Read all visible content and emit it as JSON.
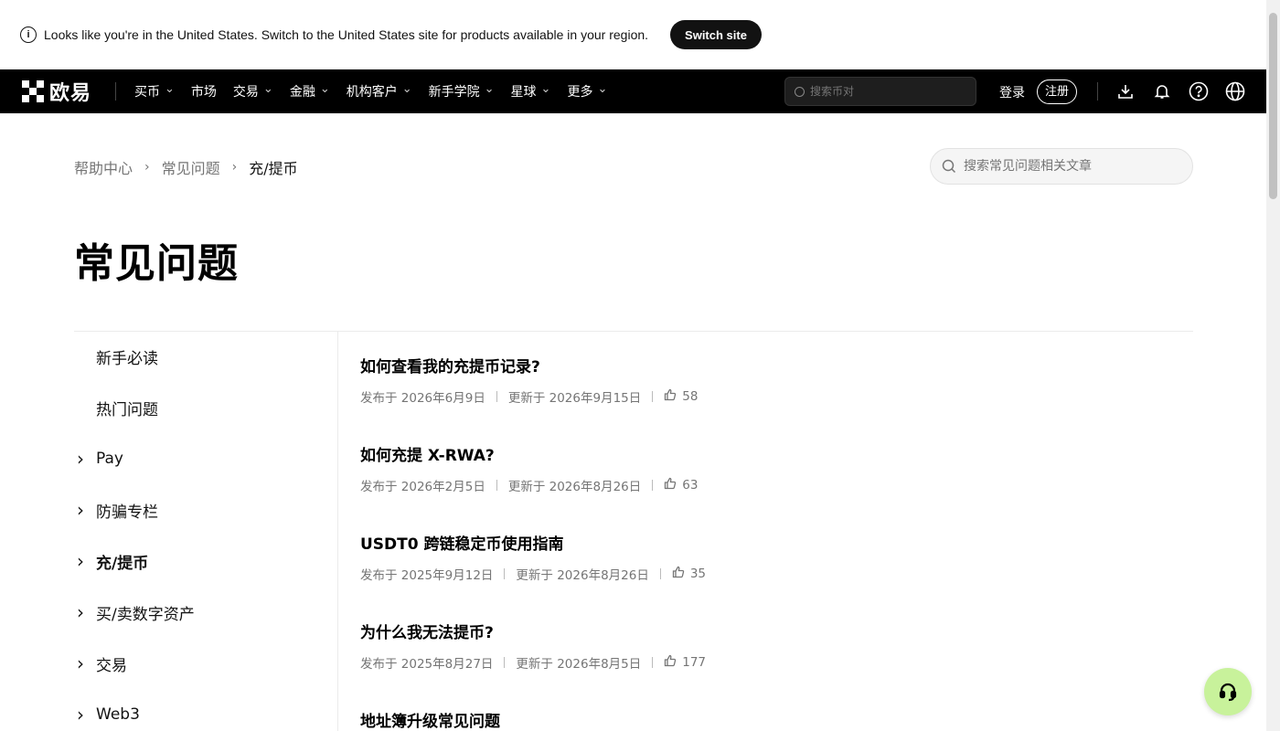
{
  "banner": {
    "message": "Looks like you're in the United States. Switch to the United States site for products available in your region.",
    "switch_label": "Switch site"
  },
  "nav": {
    "logo_text": "欧易",
    "items": [
      {
        "label": "买币",
        "has_dropdown": true
      },
      {
        "label": "市场",
        "has_dropdown": false
      },
      {
        "label": "交易",
        "has_dropdown": true
      },
      {
        "label": "金融",
        "has_dropdown": true
      },
      {
        "label": "机构客户",
        "has_dropdown": true
      },
      {
        "label": "新手学院",
        "has_dropdown": true
      },
      {
        "label": "星球",
        "has_dropdown": true
      },
      {
        "label": "更多",
        "has_dropdown": true
      }
    ],
    "search_placeholder": "搜索币对",
    "login_label": "登录",
    "register_label": "注册",
    "icons": [
      "download-icon",
      "bell-icon",
      "help-icon",
      "globe-icon"
    ]
  },
  "breadcrumb": {
    "items": [
      "帮助中心",
      "常见问题",
      "充/提币"
    ]
  },
  "help_search": {
    "placeholder": "搜索常见问题相关文章"
  },
  "page_title": "常见问题",
  "sidebar": {
    "items": [
      {
        "label": "新手必读",
        "expandable": false,
        "active": false
      },
      {
        "label": "热门问题",
        "expandable": false,
        "active": false
      },
      {
        "label": "Pay",
        "expandable": true,
        "active": false
      },
      {
        "label": "防骗专栏",
        "expandable": true,
        "active": false
      },
      {
        "label": "充/提币",
        "expandable": true,
        "active": true
      },
      {
        "label": "买/卖数字资产",
        "expandable": true,
        "active": false
      },
      {
        "label": "交易",
        "expandable": true,
        "active": false
      },
      {
        "label": "Web3",
        "expandable": true,
        "active": false
      }
    ]
  },
  "articles": [
    {
      "title": "如何查看我的充提币记录?",
      "published": "发布于 2026年6月9日",
      "updated": "更新于 2026年9月15日",
      "likes": "58"
    },
    {
      "title": "如何充提 X-RWA?",
      "published": "发布于 2026年2月5日",
      "updated": "更新于 2026年8月26日",
      "likes": "63"
    },
    {
      "title": "USDT0 跨链稳定币使用指南",
      "published": "发布于 2025年9月12日",
      "updated": "更新于 2026年8月26日",
      "likes": "35"
    },
    {
      "title": "为什么我无法提币?",
      "published": "发布于 2025年8月27日",
      "updated": "更新于 2026年8月5日",
      "likes": "177"
    },
    {
      "title": "地址簿升级常见问题",
      "published": "",
      "updated": "",
      "likes": ""
    }
  ],
  "colors": {
    "accent_support": "#c8f29b",
    "nav_bg": "#000000",
    "meta_text": "#757575"
  }
}
